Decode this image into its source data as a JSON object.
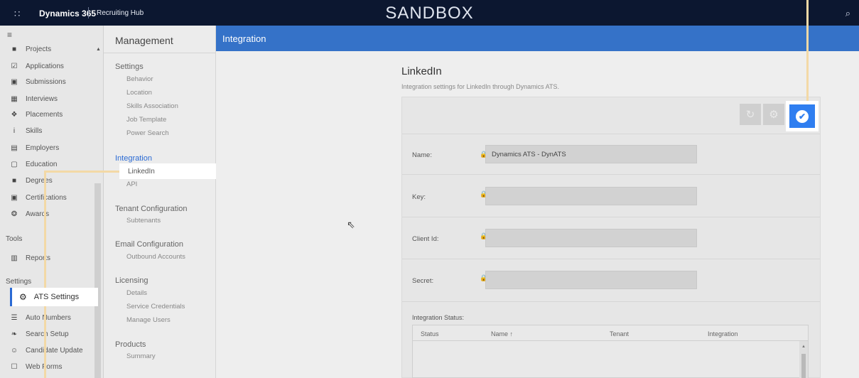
{
  "topbar": {
    "waffle_glyph": "∷",
    "brand": "Dynamics 365",
    "app_name": "Recruiting Hub",
    "environment": "SANDBOX",
    "search_glyph": "⌕"
  },
  "leftnav": {
    "menu_glyph": "≡",
    "items": [
      {
        "label": "Projects",
        "icon": "briefcase-icon",
        "glyph": "■"
      },
      {
        "label": "Applications",
        "icon": "clipboard-check-icon",
        "glyph": "☑"
      },
      {
        "label": "Submissions",
        "icon": "submission-icon",
        "glyph": "▣"
      },
      {
        "label": "Interviews",
        "icon": "calendar-icon",
        "glyph": "▦"
      },
      {
        "label": "Placements",
        "icon": "people-icon",
        "glyph": "❖"
      },
      {
        "label": "Skills",
        "icon": "skills-icon",
        "glyph": "i"
      },
      {
        "label": "Employers",
        "icon": "building-icon",
        "glyph": "▤"
      },
      {
        "label": "Education",
        "icon": "abc-icon",
        "glyph": "▢"
      },
      {
        "label": "Degrees",
        "icon": "book-icon",
        "glyph": "■"
      },
      {
        "label": "Certifications",
        "icon": "certificate-icon",
        "glyph": "▣"
      },
      {
        "label": "Awards",
        "icon": "ribbon-icon",
        "glyph": "❂"
      }
    ],
    "tools_header": "Tools",
    "tools_items": [
      {
        "label": "Reports",
        "icon": "report-icon",
        "glyph": "▥"
      }
    ],
    "settings_header": "Settings",
    "settings_items": [
      {
        "label": "ATS Settings",
        "icon": "gear-icon",
        "glyph": "⚙"
      },
      {
        "label": "Auto Numbers",
        "icon": "list-numbers-icon",
        "glyph": "☰"
      },
      {
        "label": "Search Setup",
        "icon": "search-setup-icon",
        "glyph": "❧"
      },
      {
        "label": "Candidate Update",
        "icon": "candidate-update-icon",
        "glyph": "☺"
      },
      {
        "label": "Web Forms",
        "icon": "web-form-icon",
        "glyph": "☐"
      }
    ],
    "scroll_up_glyph": "▲"
  },
  "management": {
    "title": "Management",
    "sections": [
      {
        "header": "Settings",
        "items": [
          "Behavior",
          "Location",
          "Skills Association",
          "Job Template",
          "Power Search"
        ]
      },
      {
        "header": "Integration",
        "items": [
          "LinkedIn",
          "API"
        ]
      },
      {
        "header": "Tenant Configuration",
        "items": [
          "Subtenants"
        ]
      },
      {
        "header": "Email Configuration",
        "items": [
          "Outbound Accounts"
        ]
      },
      {
        "header": "Licensing",
        "items": [
          "Details",
          "Service Credentials",
          "Manage Users"
        ]
      },
      {
        "header": "Products",
        "items": [
          "Summary"
        ]
      }
    ]
  },
  "integration": {
    "header": "Integration",
    "title": "LinkedIn",
    "subtitle": "Integration settings for LinkedIn through Dynamics ATS.",
    "toolbar": {
      "refresh_glyph": "↻",
      "settings_glyph": "⚙",
      "save_glyph": "✔"
    },
    "lock_glyph": "🔒",
    "fields": [
      {
        "label": "Name:",
        "value": "Dynamics ATS - DynATS"
      },
      {
        "label": "Key:",
        "value": ""
      },
      {
        "label": "Client Id:",
        "value": ""
      },
      {
        "label": "Secret:",
        "value": ""
      }
    ],
    "status_label": "Integration Status:",
    "columns": [
      "Status",
      "Name ↑",
      "Tenant",
      "Integration"
    ],
    "grid_scroll_glyph": "▲"
  },
  "cursor_glyph": "⇖",
  "colors": {
    "topbar": "#0c1730",
    "accent": "#3572c8",
    "save_button": "#2f7ef0",
    "callout": "#f3d9a6"
  }
}
